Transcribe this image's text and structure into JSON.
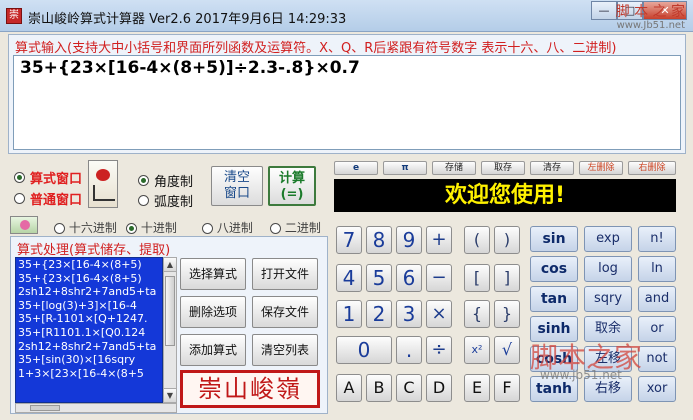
{
  "window": {
    "app_icon": "崇",
    "title": "崇山峻岭算式计算器 Ver2.6  2017年9月6日 14:29:33",
    "minimize": "—",
    "maximize": "□",
    "close": "✕",
    "watermark": "脚 本 之 家",
    "watermark_url": "www.Jb51.net"
  },
  "input_panel": {
    "label": "算式输入(支持大中小括号和界面所列函数及运算符。X、Q、R后紧跟有符号数字 表示十六、八、二进制)",
    "formula": "35+{23×[16-4×(8+5)]÷2.3-.8}×0.7"
  },
  "mode": {
    "formula_window": "算式窗口",
    "normal_window": "普通窗口",
    "degree": "角度制",
    "radian": "弧度制"
  },
  "buttons": {
    "clear_l1": "清空",
    "clear_l2": "窗口",
    "calc_l1": "计算",
    "calc_l2": "(=)"
  },
  "small_buttons": [
    "e",
    "π",
    "存储",
    "取存",
    "清存",
    "左删除",
    "右删除"
  ],
  "welcome": "欢迎您使用!",
  "bases": [
    "十六进制",
    "十进制",
    "八进制",
    "二进制"
  ],
  "history": {
    "label": "算式处理(算式储存、提取)",
    "items": [
      "35+{23×[16-4×(8+5)",
      "35+{23×[16-4×(8+5)",
      "2sh12+8shr2+7and5+ta",
      "35+[log(3)+3]×[16-4",
      "35+[R-1101×[Q+1247.",
      "35+[R1101.1×[Q0.124",
      "2sh12+8shr2+7and5+ta",
      "35+[sin(30)×[16sqry",
      "1+3×[23×[16-4×(8+5"
    ],
    "buttons": [
      "选择算式",
      "打开文件",
      "删除选项",
      "保存文件",
      "添加算式",
      "清空列表"
    ],
    "seal": "崇山峻嶺"
  },
  "keypad": {
    "digits": [
      "7",
      "8",
      "9",
      "4",
      "5",
      "6",
      "1",
      "2",
      "3",
      "0",
      "."
    ],
    "ops": [
      "+",
      "−",
      "×",
      "÷"
    ],
    "brackets": [
      "(",
      ")",
      "[",
      "]",
      "{",
      "}"
    ],
    "power": "x²",
    "sqrt": "√",
    "hex": [
      "A",
      "B",
      "C",
      "D",
      "E",
      "F"
    ]
  },
  "functions": [
    "sin",
    "exp",
    "n!",
    "cos",
    "log",
    "ln",
    "tan",
    "sqry",
    "and",
    "sinh",
    "取余",
    "or",
    "cosh",
    "左移",
    "not",
    "tanh",
    "右移",
    "xor"
  ],
  "bottom_watermark": "脚本之家",
  "bottom_watermark_url": "www.jb51.net"
}
